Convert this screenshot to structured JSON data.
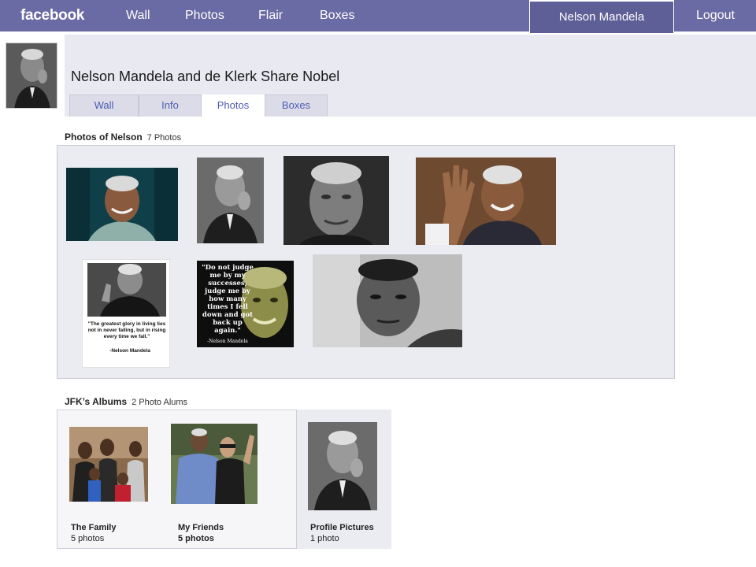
{
  "topbar": {
    "logo": "facebook",
    "nav": [
      "Wall",
      "Photos",
      "Flair",
      "Boxes"
    ],
    "user": "Nelson Mandela",
    "logout": "Logout"
  },
  "profile": {
    "name": "Nelson Mandela and de Klerk Share Nobel",
    "tabs": [
      {
        "label": "Wall"
      },
      {
        "label": "Info"
      },
      {
        "label": "Photos",
        "active": true
      },
      {
        "label": "Boxes"
      }
    ]
  },
  "photos_section": {
    "title": "Photos of Nelson",
    "count": "7 Photos",
    "photos": [
      {
        "caption": ""
      },
      {
        "caption": ""
      },
      {
        "caption": ""
      },
      {
        "caption": ""
      },
      {
        "caption": "\"The greatest glory in living lies not in never falling, but in rising every time we fall.\"",
        "attribution": "-Nelson Mandela"
      },
      {
        "caption": "\"Do not judge me by my successes, judge me by how many times I fell down and got back up again.\"",
        "attribution": "-Nelson Mandela"
      },
      {
        "caption": ""
      }
    ]
  },
  "albums_section": {
    "title": "JFK’s Albums",
    "count": "2 Photo Alums",
    "albums": [
      {
        "title": "The Family",
        "count": "5 photos"
      },
      {
        "title": "My Friends",
        "count": "5 photos"
      },
      {
        "title": "Profile Pictures",
        "count": "1 photo"
      }
    ]
  },
  "colors": {
    "topbar": "#6a6aa5",
    "panel": "#e9e9f1",
    "tab_text": "#4d5ab3"
  }
}
